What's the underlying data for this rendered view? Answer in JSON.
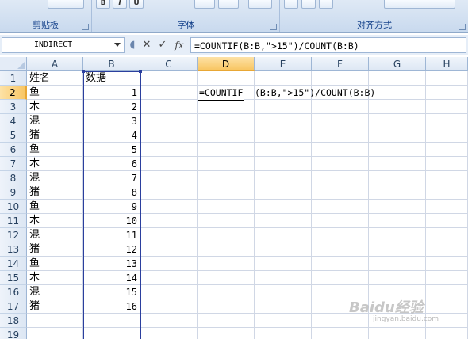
{
  "ribbon": {
    "groups": [
      {
        "label": "剪贴板"
      },
      {
        "label": "字体"
      },
      {
        "label": "对齐方式"
      }
    ],
    "top_buttons": [
      "B",
      "I",
      "U"
    ]
  },
  "formula_bar": {
    "name_box": "INDIRECT",
    "cancel_symbol": "✕",
    "enter_symbol": "✓",
    "fx_symbol": "fx",
    "formula": "=COUNTIF(B:B,\">15\")/COUNT(B:B)"
  },
  "columns": [
    "A",
    "B",
    "C",
    "D",
    "E",
    "F",
    "G",
    "H"
  ],
  "active_column": "D",
  "active_row": "2",
  "rows": [
    "1",
    "2",
    "3",
    "4",
    "5",
    "6",
    "7",
    "8",
    "9",
    "10",
    "11",
    "12",
    "13",
    "14",
    "15",
    "16",
    "17",
    "18",
    "19"
  ],
  "header_row": {
    "a": "姓名",
    "b": "数据"
  },
  "data_rows": [
    {
      "a": "鱼",
      "b": "1"
    },
    {
      "a": "木",
      "b": "2"
    },
    {
      "a": "混",
      "b": "3"
    },
    {
      "a": "猪",
      "b": "4"
    },
    {
      "a": "鱼",
      "b": "5"
    },
    {
      "a": "木",
      "b": "6"
    },
    {
      "a": "混",
      "b": "7"
    },
    {
      "a": "猪",
      "b": "8"
    },
    {
      "a": "鱼",
      "b": "9"
    },
    {
      "a": "木",
      "b": "10"
    },
    {
      "a": "混",
      "b": "11"
    },
    {
      "a": "猪",
      "b": "12"
    },
    {
      "a": "鱼",
      "b": "13"
    },
    {
      "a": "木",
      "b": "14"
    },
    {
      "a": "混",
      "b": "15"
    },
    {
      "a": "猪",
      "b": "16"
    }
  ],
  "editing": {
    "cell_text": "=COUNTIF",
    "rest_text": "(B:B,\">15\")/COUNT(B:B)"
  },
  "watermark": {
    "text": "Baidu经验",
    "sub": "jingyan.baidu.com"
  },
  "colors": {
    "selection_border": "#2b3f9e",
    "active_header": "#f8c664"
  }
}
